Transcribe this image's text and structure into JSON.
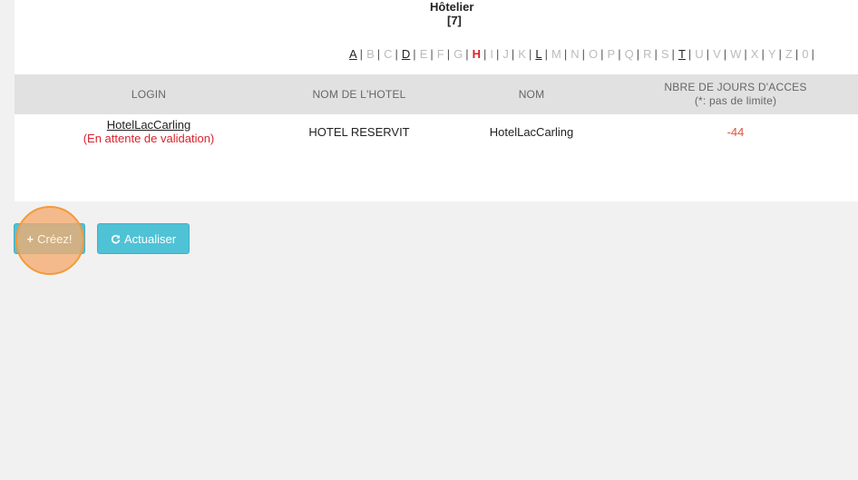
{
  "header": {
    "title": "Hôtelier",
    "count": "[7]"
  },
  "alphabet": [
    {
      "letter": "A",
      "state": "on"
    },
    {
      "letter": "B",
      "state": "off"
    },
    {
      "letter": "C",
      "state": "off"
    },
    {
      "letter": "D",
      "state": "on"
    },
    {
      "letter": "E",
      "state": "off"
    },
    {
      "letter": "F",
      "state": "off"
    },
    {
      "letter": "G",
      "state": "off"
    },
    {
      "letter": "H",
      "state": "cur"
    },
    {
      "letter": "I",
      "state": "off"
    },
    {
      "letter": "J",
      "state": "off"
    },
    {
      "letter": "K",
      "state": "off"
    },
    {
      "letter": "L",
      "state": "on"
    },
    {
      "letter": "M",
      "state": "off"
    },
    {
      "letter": "N",
      "state": "off"
    },
    {
      "letter": "O",
      "state": "off"
    },
    {
      "letter": "P",
      "state": "off"
    },
    {
      "letter": "Q",
      "state": "off"
    },
    {
      "letter": "R",
      "state": "off"
    },
    {
      "letter": "S",
      "state": "off"
    },
    {
      "letter": "T",
      "state": "on"
    },
    {
      "letter": "U",
      "state": "off"
    },
    {
      "letter": "V",
      "state": "off"
    },
    {
      "letter": "W",
      "state": "off"
    },
    {
      "letter": "X",
      "state": "off"
    },
    {
      "letter": "Y",
      "state": "off"
    },
    {
      "letter": "Z",
      "state": "off"
    },
    {
      "letter": "0",
      "state": "off"
    }
  ],
  "table": {
    "headers": {
      "login": "LOGIN",
      "hotel_name": "NOM DE L'HOTEL",
      "name": "NOM",
      "days_line1": "NBRE DE JOURS D'ACCES",
      "days_line2": "(*: pas de limite)"
    },
    "rows": [
      {
        "login": "HotelLacCarling",
        "status": "(En attente de validation)",
        "hotel_name": "HOTEL RESERVIT",
        "name": "HotelLacCarling",
        "days": "-44"
      }
    ]
  },
  "buttons": {
    "create_label": "Créez!",
    "create_icon": "plus-icon",
    "refresh_label": "Actualiser",
    "refresh_icon": "refresh-icon"
  },
  "colors": {
    "accent": "#4fc2d6",
    "current_letter": "#d9232d",
    "pending": "#d9232d",
    "negative_days": "#e0533f",
    "click_highlight": "#f29a3c"
  }
}
